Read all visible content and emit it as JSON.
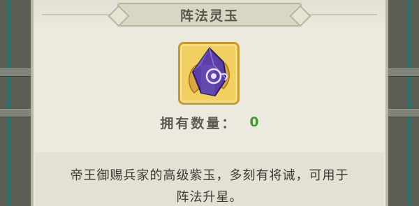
{
  "dialog": {
    "title": "阵法灵玉"
  },
  "item": {
    "icon": "purple-jade-crystal-icon",
    "count_label": "拥有数量：",
    "count_value": "0"
  },
  "description": {
    "line1": "帝王御赐兵家的高级紫玉，多刻有将诫，可用于",
    "line2": "阵法升星。"
  },
  "colors": {
    "panel_bg": "#eceadf",
    "count_value": "#3f9a2c",
    "item_frame": "#f2cf61",
    "gem": "#5b3fa6"
  }
}
